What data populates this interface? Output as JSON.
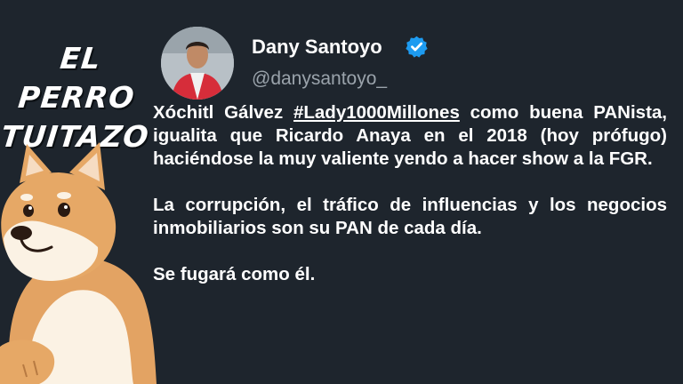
{
  "brand": {
    "line1": "EL PERRO",
    "line2": "TUITAZO"
  },
  "author": {
    "name": "Dany Santoyo",
    "handle": "@danysantoyo_",
    "verified_icon": "verified-badge-icon",
    "avatar_icon": "profile-photo"
  },
  "tweet": {
    "p1_before": "Xóchitl Gálvez ",
    "p1_hashtag": "#Lady1000Millones",
    "p1_after": " como buena PANista, igualita que Ricardo Anaya en el 2018 (hoy prófugo) haciéndose la muy valiente yendo a hacer show a la FGR.",
    "p2": "La corrupción, el tráfico de influencias y los negocios inmobiliarios son su PAN de cada día.",
    "p3": "Se fugará como él."
  },
  "colors": {
    "background": "#1e252d",
    "text": "#ffffff",
    "handle": "#9aa3ab",
    "verified": "#1d9bf0"
  }
}
